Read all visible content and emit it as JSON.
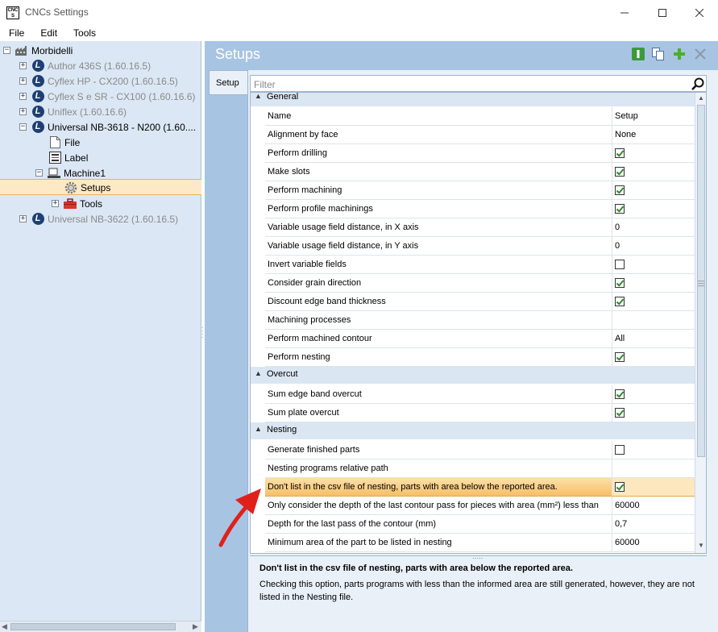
{
  "window": {
    "title": "CNCs Settings",
    "app_icon_text": [
      "CNC",
      "S"
    ]
  },
  "menu": [
    "File",
    "Edit",
    "Tools"
  ],
  "tree": {
    "root": "Morbidelli",
    "items": [
      {
        "label": "Author 436S (1.60.16.5)",
        "state": "collapsed",
        "gray": true
      },
      {
        "label": "Cyflex HP - CX200 (1.60.16.5)",
        "state": "collapsed",
        "gray": true
      },
      {
        "label": "Cyflex S e SR - CX100 (1.60.16.6)",
        "state": "collapsed",
        "gray": true
      },
      {
        "label": "Uniflex (1.60.16.6)",
        "state": "collapsed",
        "gray": true
      },
      {
        "label": "Universal NB-3618 - N200 (1.60....",
        "state": "expanded",
        "gray": false
      },
      {
        "label": "File"
      },
      {
        "label": "Label"
      },
      {
        "label": "Machine1",
        "state": "expanded"
      },
      {
        "label": "Setups",
        "selected": true
      },
      {
        "label": "Tools",
        "state": "collapsed"
      },
      {
        "label": "Universal NB-3622 (1.60.16.5)",
        "state": "collapsed",
        "gray": true
      }
    ]
  },
  "right": {
    "title": "Setups",
    "tab": "Setup",
    "filter_placeholder": "Filter"
  },
  "grid": {
    "sections": [
      {
        "label": "General"
      },
      {
        "label": "Overcut"
      },
      {
        "label": "Nesting"
      }
    ],
    "header": {
      "name": "Name",
      "value": "Setup"
    },
    "rows": [
      {
        "name": "Alignment by face",
        "value": "None"
      },
      {
        "name": "Perform drilling",
        "checked": true
      },
      {
        "name": "Make slots",
        "checked": true
      },
      {
        "name": "Perform machining",
        "checked": true
      },
      {
        "name": "Perform profile machinings",
        "checked": true
      },
      {
        "name": "Variable usage field distance, in X axis",
        "value": "0"
      },
      {
        "name": "Variable usage field distance, in Y axis",
        "value": "0"
      },
      {
        "name": "Invert variable fields",
        "checked": false
      },
      {
        "name": "Consider grain direction",
        "checked": true
      },
      {
        "name": "Discount edge band thickness",
        "checked": true
      },
      {
        "name": "Machining processes",
        "value": ""
      },
      {
        "name": "Perform machined contour",
        "value": "All"
      },
      {
        "name": "Perform nesting",
        "checked": true
      },
      {
        "name": "Sum edge band overcut",
        "checked": true
      },
      {
        "name": "Sum plate overcut",
        "checked": true
      },
      {
        "name": "Generate finished parts",
        "checked": false
      },
      {
        "name": "Nesting programs relative path",
        "value": ""
      },
      {
        "name": "Don't list in the csv file of nesting, parts with area below the reported area.",
        "checked": true,
        "selected": true
      },
      {
        "name": "Only consider the depth of the last contour pass for pieces with area (mm²) less than",
        "value": "60000"
      },
      {
        "name": "Depth for the last pass of the contour (mm)",
        "value": "0,7"
      },
      {
        "name": "Minimum area of the part to be listed in nesting",
        "value": "60000"
      }
    ]
  },
  "description": {
    "title": "Don't list in the csv file of nesting, parts with area below the reported area.",
    "body": "Checking this option, parts programs with less than the informed area are still generated, however, they are not listed in the Nesting file."
  },
  "colors": {
    "tree_bg": "#dbe7f4",
    "panel_bg": "#a8c4e3",
    "selection": "#fde9c5",
    "row_highlight": "#f7bf66",
    "arrow": "#e0201b"
  }
}
